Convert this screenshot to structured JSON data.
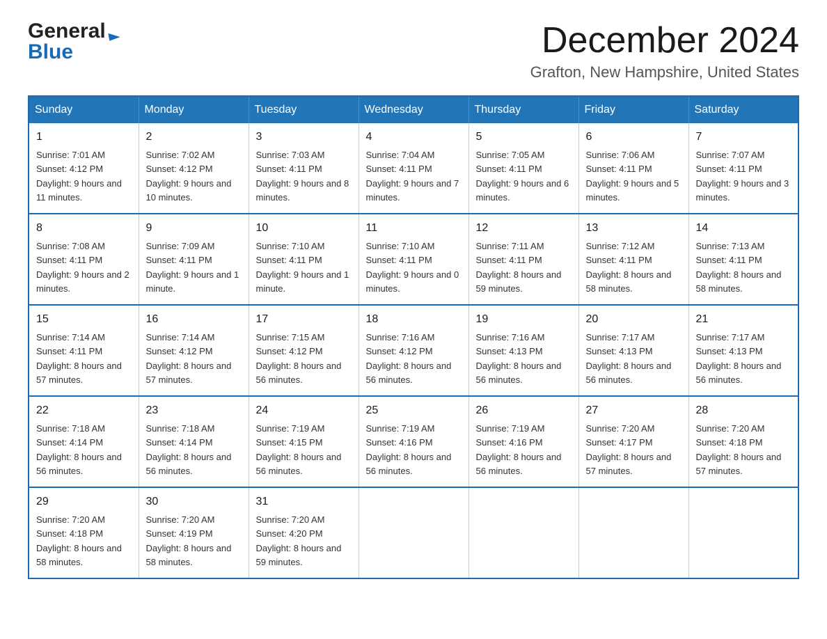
{
  "header": {
    "month_title": "December 2024",
    "location": "Grafton, New Hampshire, United States"
  },
  "logo": {
    "line1": "General",
    "line2": "Blue"
  },
  "days_of_week": [
    "Sunday",
    "Monday",
    "Tuesday",
    "Wednesday",
    "Thursday",
    "Friday",
    "Saturday"
  ],
  "weeks": [
    [
      {
        "day": "1",
        "sunrise": "Sunrise: 7:01 AM",
        "sunset": "Sunset: 4:12 PM",
        "daylight": "Daylight: 9 hours and 11 minutes."
      },
      {
        "day": "2",
        "sunrise": "Sunrise: 7:02 AM",
        "sunset": "Sunset: 4:12 PM",
        "daylight": "Daylight: 9 hours and 10 minutes."
      },
      {
        "day": "3",
        "sunrise": "Sunrise: 7:03 AM",
        "sunset": "Sunset: 4:11 PM",
        "daylight": "Daylight: 9 hours and 8 minutes."
      },
      {
        "day": "4",
        "sunrise": "Sunrise: 7:04 AM",
        "sunset": "Sunset: 4:11 PM",
        "daylight": "Daylight: 9 hours and 7 minutes."
      },
      {
        "day": "5",
        "sunrise": "Sunrise: 7:05 AM",
        "sunset": "Sunset: 4:11 PM",
        "daylight": "Daylight: 9 hours and 6 minutes."
      },
      {
        "day": "6",
        "sunrise": "Sunrise: 7:06 AM",
        "sunset": "Sunset: 4:11 PM",
        "daylight": "Daylight: 9 hours and 5 minutes."
      },
      {
        "day": "7",
        "sunrise": "Sunrise: 7:07 AM",
        "sunset": "Sunset: 4:11 PM",
        "daylight": "Daylight: 9 hours and 3 minutes."
      }
    ],
    [
      {
        "day": "8",
        "sunrise": "Sunrise: 7:08 AM",
        "sunset": "Sunset: 4:11 PM",
        "daylight": "Daylight: 9 hours and 2 minutes."
      },
      {
        "day": "9",
        "sunrise": "Sunrise: 7:09 AM",
        "sunset": "Sunset: 4:11 PM",
        "daylight": "Daylight: 9 hours and 1 minute."
      },
      {
        "day": "10",
        "sunrise": "Sunrise: 7:10 AM",
        "sunset": "Sunset: 4:11 PM",
        "daylight": "Daylight: 9 hours and 1 minute."
      },
      {
        "day": "11",
        "sunrise": "Sunrise: 7:10 AM",
        "sunset": "Sunset: 4:11 PM",
        "daylight": "Daylight: 9 hours and 0 minutes."
      },
      {
        "day": "12",
        "sunrise": "Sunrise: 7:11 AM",
        "sunset": "Sunset: 4:11 PM",
        "daylight": "Daylight: 8 hours and 59 minutes."
      },
      {
        "day": "13",
        "sunrise": "Sunrise: 7:12 AM",
        "sunset": "Sunset: 4:11 PM",
        "daylight": "Daylight: 8 hours and 58 minutes."
      },
      {
        "day": "14",
        "sunrise": "Sunrise: 7:13 AM",
        "sunset": "Sunset: 4:11 PM",
        "daylight": "Daylight: 8 hours and 58 minutes."
      }
    ],
    [
      {
        "day": "15",
        "sunrise": "Sunrise: 7:14 AM",
        "sunset": "Sunset: 4:11 PM",
        "daylight": "Daylight: 8 hours and 57 minutes."
      },
      {
        "day": "16",
        "sunrise": "Sunrise: 7:14 AM",
        "sunset": "Sunset: 4:12 PM",
        "daylight": "Daylight: 8 hours and 57 minutes."
      },
      {
        "day": "17",
        "sunrise": "Sunrise: 7:15 AM",
        "sunset": "Sunset: 4:12 PM",
        "daylight": "Daylight: 8 hours and 56 minutes."
      },
      {
        "day": "18",
        "sunrise": "Sunrise: 7:16 AM",
        "sunset": "Sunset: 4:12 PM",
        "daylight": "Daylight: 8 hours and 56 minutes."
      },
      {
        "day": "19",
        "sunrise": "Sunrise: 7:16 AM",
        "sunset": "Sunset: 4:13 PM",
        "daylight": "Daylight: 8 hours and 56 minutes."
      },
      {
        "day": "20",
        "sunrise": "Sunrise: 7:17 AM",
        "sunset": "Sunset: 4:13 PM",
        "daylight": "Daylight: 8 hours and 56 minutes."
      },
      {
        "day": "21",
        "sunrise": "Sunrise: 7:17 AM",
        "sunset": "Sunset: 4:13 PM",
        "daylight": "Daylight: 8 hours and 56 minutes."
      }
    ],
    [
      {
        "day": "22",
        "sunrise": "Sunrise: 7:18 AM",
        "sunset": "Sunset: 4:14 PM",
        "daylight": "Daylight: 8 hours and 56 minutes."
      },
      {
        "day": "23",
        "sunrise": "Sunrise: 7:18 AM",
        "sunset": "Sunset: 4:14 PM",
        "daylight": "Daylight: 8 hours and 56 minutes."
      },
      {
        "day": "24",
        "sunrise": "Sunrise: 7:19 AM",
        "sunset": "Sunset: 4:15 PM",
        "daylight": "Daylight: 8 hours and 56 minutes."
      },
      {
        "day": "25",
        "sunrise": "Sunrise: 7:19 AM",
        "sunset": "Sunset: 4:16 PM",
        "daylight": "Daylight: 8 hours and 56 minutes."
      },
      {
        "day": "26",
        "sunrise": "Sunrise: 7:19 AM",
        "sunset": "Sunset: 4:16 PM",
        "daylight": "Daylight: 8 hours and 56 minutes."
      },
      {
        "day": "27",
        "sunrise": "Sunrise: 7:20 AM",
        "sunset": "Sunset: 4:17 PM",
        "daylight": "Daylight: 8 hours and 57 minutes."
      },
      {
        "day": "28",
        "sunrise": "Sunrise: 7:20 AM",
        "sunset": "Sunset: 4:18 PM",
        "daylight": "Daylight: 8 hours and 57 minutes."
      }
    ],
    [
      {
        "day": "29",
        "sunrise": "Sunrise: 7:20 AM",
        "sunset": "Sunset: 4:18 PM",
        "daylight": "Daylight: 8 hours and 58 minutes."
      },
      {
        "day": "30",
        "sunrise": "Sunrise: 7:20 AM",
        "sunset": "Sunset: 4:19 PM",
        "daylight": "Daylight: 8 hours and 58 minutes."
      },
      {
        "day": "31",
        "sunrise": "Sunrise: 7:20 AM",
        "sunset": "Sunset: 4:20 PM",
        "daylight": "Daylight: 8 hours and 59 minutes."
      },
      null,
      null,
      null,
      null
    ]
  ]
}
